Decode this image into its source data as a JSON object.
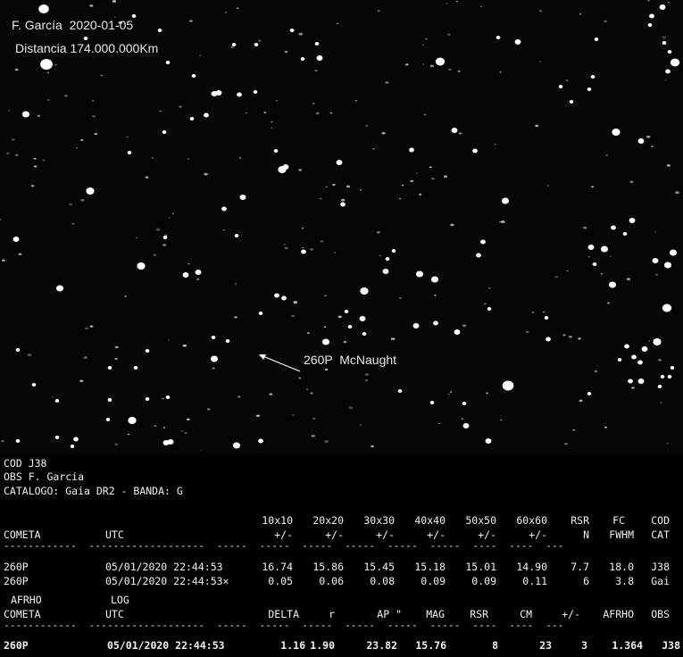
{
  "overlay": {
    "observer_date": "F. García  2020-01-05",
    "distance": "Distancia 174.000.000Km",
    "comet_label": "260P  McNaught"
  },
  "report": {
    "header_lines": [
      "COD J38",
      "OBS F. Garcia",
      "CATALOGO: Gaia DR2 - BANDA: G"
    ],
    "table1": {
      "top_headers": [
        "10x10",
        "20x20",
        "30x30",
        "40x40",
        "50x50",
        "60x60",
        "RSR",
        "FC",
        "COD"
      ],
      "headers": [
        "COMETA",
        "UTC",
        "+/-",
        "+/-",
        "+/-",
        "+/-",
        "+/-",
        "+/-",
        "N",
        "FWHM",
        "CAT"
      ],
      "separator": "------------  -------------------  -----  -----  -----  -----  -----  -----  ----  ----  ---",
      "rows": [
        [
          "260P",
          "05/01/2020 22:44:53",
          "16.74",
          "15.86",
          "15.45",
          "15.18",
          "15.01",
          "14.90",
          "7.7",
          "18.0",
          "J38"
        ],
        [
          "260P",
          "05/01/2020 22:44:53×",
          "0.05",
          "0.06",
          "0.08",
          "0.09",
          "0.09",
          "0.11",
          "6",
          "3.8",
          "Gai"
        ]
      ]
    },
    "table2": {
      "top_headers": [
        "AFRHO",
        "LOG"
      ],
      "headers": [
        "COMETA",
        "UTC",
        "DELTA",
        "r",
        "AP \"",
        "MAG",
        "RSR",
        "CM",
        "+/-",
        "AFRHO",
        "OBS"
      ],
      "separator": "------------  -------------------  -----  -----  -----  -----  -----  -----  ----  ----  ---",
      "row": [
        "260P",
        "05/01/2020 22:44:53",
        "1.16",
        "1.90",
        "23.82",
        "15.76",
        "8",
        "23",
        "3",
        "1.364",
        "J38"
      ]
    }
  },
  "colors": {
    "sky": "#050505",
    "star": "#ffffff",
    "text": "#f2f2f2"
  }
}
